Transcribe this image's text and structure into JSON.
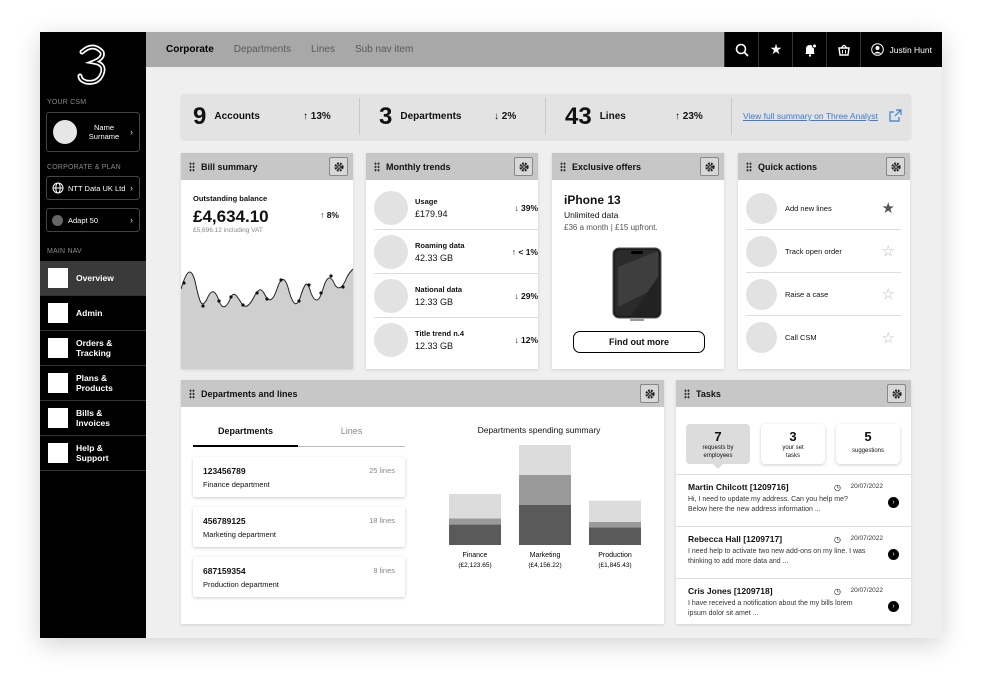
{
  "sidebar": {
    "csm_label": "YOUR CSM",
    "csm_name": "Name Surname",
    "corporate_label": "CORPORATE & PLAN",
    "company": "NTT Data UK Ltd",
    "plan": "Adapt 50",
    "main_nav_label": "MAIN NAV",
    "items": [
      {
        "label": "Overview"
      },
      {
        "label": "Admin"
      },
      {
        "label": "Orders & Tracking"
      },
      {
        "label": "Plans & Products"
      },
      {
        "label": "Bills & Invoices"
      },
      {
        "label": "Help & Support"
      }
    ]
  },
  "topbar": {
    "tabs": [
      "Corporate",
      "Departments",
      "Lines",
      "Sub nav item"
    ],
    "user": "Justin Hunt",
    "icons": [
      "search-icon",
      "star-icon",
      "notification-icon",
      "basket-icon",
      "user-icon"
    ]
  },
  "kpis": [
    {
      "value": "9",
      "label": "Accounts",
      "trend": "↑ 13%"
    },
    {
      "value": "3",
      "label": "Departments",
      "trend": "↓ 2%"
    },
    {
      "value": "43",
      "label": "Lines",
      "trend": "↑ 23%"
    }
  ],
  "kpi_link": "View full summary on Three Analyst",
  "bill": {
    "title": "Bill summary",
    "label": "Outstanding balance",
    "amount": "£4,634.10",
    "trend": "↑ 8%",
    "vat": "£5,696.12 including VAT"
  },
  "trends": {
    "title": "Monthly trends",
    "rows": [
      {
        "label": "Usage",
        "value": "£179.94",
        "trend": "↓ 39%"
      },
      {
        "label": "Roaming data",
        "value": "42.33 GB",
        "trend": "↑ < 1%"
      },
      {
        "label": "National data",
        "value": "12.33 GB",
        "trend": "↓ 29%"
      },
      {
        "label": "Title trend n.4",
        "value": "12.33 GB",
        "trend": "↓ 12%"
      }
    ]
  },
  "offers": {
    "title": "Exclusive offers",
    "product": "iPhone 13",
    "line1": "Unlimited data",
    "line2": "£36 a month | £15 upfront.",
    "button": "Find out more"
  },
  "quick": {
    "title": "Quick actions",
    "items": [
      "Add new lines",
      "Track open order",
      "Raise a case",
      "Call CSM"
    ]
  },
  "depts": {
    "title": "Departments and lines",
    "tabs": [
      "Departments",
      "Lines"
    ],
    "list": [
      {
        "code": "123456789",
        "name": "Finance department",
        "lines": "25 lines"
      },
      {
        "code": "456789125",
        "name": "Marketing department",
        "lines": "18 lines"
      },
      {
        "code": "687159354",
        "name": "Production department",
        "lines": "8 lines"
      }
    ],
    "chart_title": "Departments spending summary"
  },
  "chart_data": {
    "type": "bar",
    "title": "Departments spending summary",
    "categories": [
      "Finance",
      "Marketing",
      "Production"
    ],
    "sublabels": [
      "(£2,123.65)",
      "(£4,156.22)",
      "(£1,845.43)"
    ],
    "values": [
      2123.65,
      4156.22,
      1845.43
    ]
  },
  "tasks": {
    "title": "Tasks",
    "counts": [
      {
        "n": "7",
        "d": "requests by employees"
      },
      {
        "n": "3",
        "d": "your set tasks"
      },
      {
        "n": "5",
        "d": "suggestions"
      }
    ],
    "items": [
      {
        "name": "Martin Chilcott  [1209716]",
        "date": "20/07/2022",
        "text": "Hi, I need to update my address. Can you help me? Below here the new address information ..."
      },
      {
        "name": "Rebecca Hall  [1209717]",
        "date": "20/07/2022",
        "text": "I need help to activate two new add-ons on my line. I was thinking to add more data and ..."
      },
      {
        "name": "Cris Jones  [1209718]",
        "date": "20/07/2022",
        "text": "I have received a notification about the my bills lorem ipsum dolor sit amet ..."
      }
    ]
  }
}
